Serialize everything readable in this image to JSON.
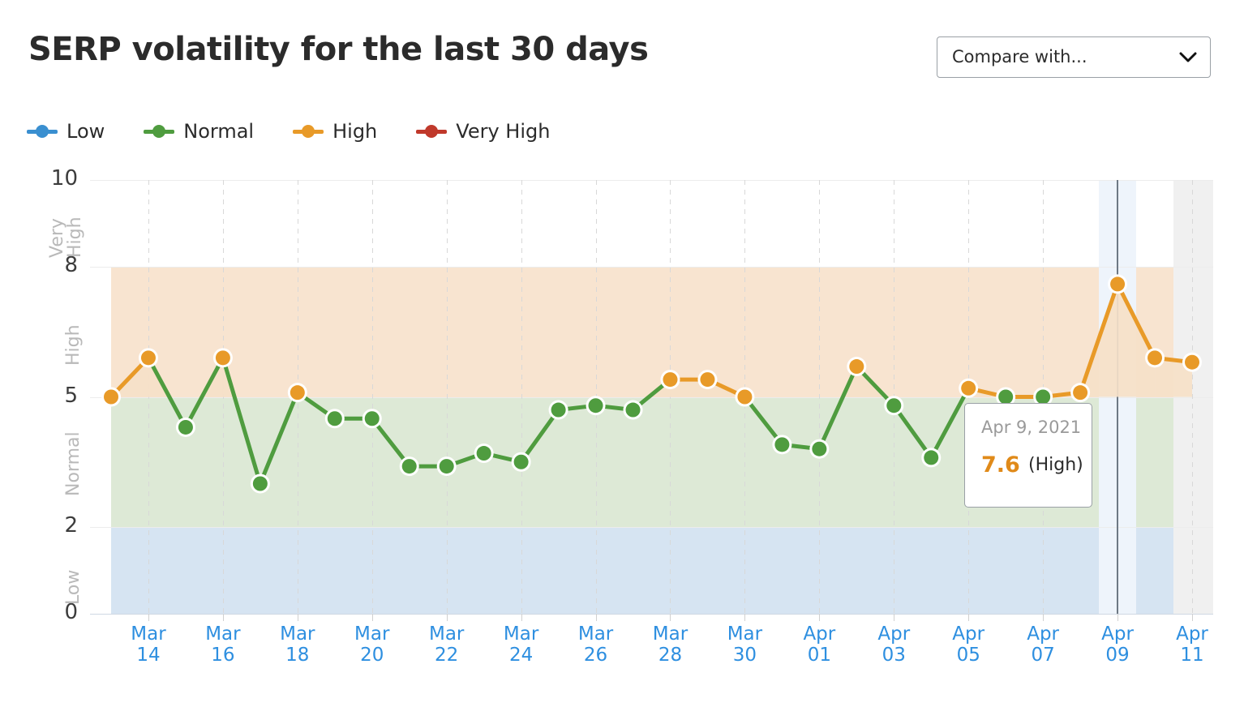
{
  "header": {
    "title": "SERP volatility for the last 30 days",
    "compare": {
      "label": "Compare with...",
      "icon": "chevron-down-icon"
    }
  },
  "legend": {
    "items": [
      {
        "label": "Low",
        "color": "#3a8fd0"
      },
      {
        "label": "Normal",
        "color": "#4f9c3f"
      },
      {
        "label": "High",
        "color": "#e89a28"
      },
      {
        "label": "Very High",
        "color": "#c0392b"
      }
    ]
  },
  "tooltip": {
    "date": "Apr 9, 2021",
    "value": "7.6",
    "state": "(High)"
  },
  "chart_data": {
    "type": "line",
    "title": "SERP volatility for the last 30 days",
    "xlabel": "",
    "ylabel": "",
    "ylim": [
      0,
      10
    ],
    "yticks": [
      0,
      2,
      5,
      8,
      10
    ],
    "grid": true,
    "legend_position": "top-left",
    "bands": [
      {
        "name": "Low",
        "from": 0,
        "to": 2,
        "color": "#d6e4f2",
        "label_color": "#b9b9b9"
      },
      {
        "name": "Normal",
        "from": 2,
        "to": 5,
        "color": "#dde9d6",
        "label_color": "#b9b9b9"
      },
      {
        "name": "High",
        "from": 5,
        "to": 8,
        "color": "#f8e4d0",
        "label_color": "#b9b9b9"
      },
      {
        "name": "Very High",
        "from": 8,
        "to": 10,
        "color": "#fae0dd",
        "label_color": "#b9b9b9"
      }
    ],
    "x_tick_labels": [
      {
        "month": "Mar",
        "day": "14"
      },
      {
        "month": "Mar",
        "day": "16"
      },
      {
        "month": "Mar",
        "day": "18"
      },
      {
        "month": "Mar",
        "day": "20"
      },
      {
        "month": "Mar",
        "day": "22"
      },
      {
        "month": "Mar",
        "day": "24"
      },
      {
        "month": "Mar",
        "day": "26"
      },
      {
        "month": "Mar",
        "day": "28"
      },
      {
        "month": "Mar",
        "day": "30"
      },
      {
        "month": "Apr",
        "day": "01"
      },
      {
        "month": "Apr",
        "day": "03"
      },
      {
        "month": "Apr",
        "day": "05"
      },
      {
        "month": "Apr",
        "day": "07"
      },
      {
        "month": "Apr",
        "day": "09"
      },
      {
        "month": "Apr",
        "day": "11"
      }
    ],
    "x": [
      "Mar 13",
      "Mar 14",
      "Mar 15",
      "Mar 16",
      "Mar 17",
      "Mar 18",
      "Mar 19",
      "Mar 20",
      "Mar 21",
      "Mar 22",
      "Mar 23",
      "Mar 24",
      "Mar 25",
      "Mar 26",
      "Mar 27",
      "Mar 28",
      "Mar 29",
      "Mar 30",
      "Mar 31",
      "Apr 01",
      "Apr 02",
      "Apr 03",
      "Apr 04",
      "Apr 05",
      "Apr 06",
      "Apr 07",
      "Apr 08",
      "Apr 09",
      "Apr 10",
      "Apr 11"
    ],
    "values": [
      5.0,
      5.9,
      4.3,
      5.9,
      3.0,
      5.1,
      4.5,
      4.5,
      3.4,
      3.4,
      3.7,
      3.5,
      4.7,
      4.8,
      4.7,
      5.4,
      5.4,
      5.0,
      3.9,
      3.8,
      5.7,
      4.8,
      3.6,
      5.2,
      5.0,
      5.0,
      5.1,
      7.6,
      5.9,
      5.8
    ],
    "point_states": [
      "High",
      "High",
      "Normal",
      "High",
      "Normal",
      "High",
      "Normal",
      "Normal",
      "Normal",
      "Normal",
      "Normal",
      "Normal",
      "Normal",
      "Normal",
      "Normal",
      "High",
      "High",
      "High",
      "Normal",
      "Normal",
      "High",
      "Normal",
      "Normal",
      "High",
      "Normal",
      "Normal",
      "High",
      "High",
      "High",
      "High"
    ],
    "highlighted_point": {
      "x": "Apr 09",
      "value": 7.6,
      "state": "High"
    },
    "colors": {
      "low": "#3a8fd0",
      "normal": "#4f9c3f",
      "high": "#e89a28",
      "very_high": "#c0392b",
      "axis_label": "#2e8fe0"
    }
  }
}
